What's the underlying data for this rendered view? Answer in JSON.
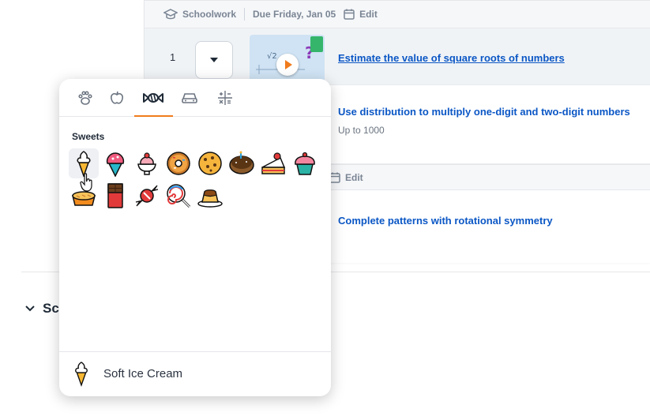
{
  "assignment": {
    "meta": {
      "type": "Schoolwork",
      "due": "Due Friday, Jan 05",
      "edit": "Edit",
      "edit2": "Edit"
    },
    "items": [
      {
        "number": "1",
        "title": "Estimate the value of square roots of numbers"
      },
      {
        "title": "Use distribution to multiply one-digit and two-digit numbers",
        "subtitle": "Up to 1000"
      },
      {
        "title": "Complete patterns with rotational symmetry"
      }
    ],
    "section_heading": "Sc"
  },
  "picker": {
    "tabs": [
      {
        "icon": "paw-icon"
      },
      {
        "icon": "apple-icon"
      },
      {
        "icon": "candy-icon",
        "active": true
      },
      {
        "icon": "car-icon"
      },
      {
        "icon": "symbols-icon"
      }
    ],
    "category": "Sweets",
    "emojis": [
      "soft-ice-cream",
      "shaved-ice",
      "ice-cream-sundae",
      "doughnut",
      "cookie",
      "chocolate-doughnut",
      "shortcake",
      "cupcake",
      "pie",
      "chocolate-bar",
      "candy",
      "lollipop",
      "custard"
    ],
    "selected": {
      "name": "Soft Ice Cream",
      "icon": "soft-ice-cream"
    }
  },
  "colors": {
    "accent": "#f07c1c",
    "link": "#0b57c5"
  }
}
